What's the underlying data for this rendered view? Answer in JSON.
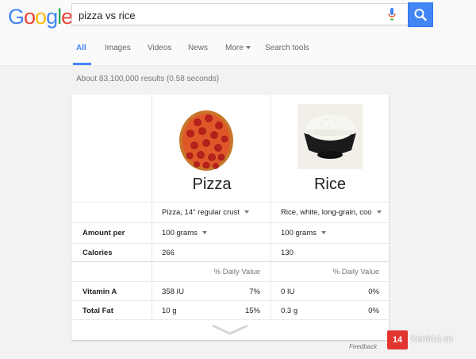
{
  "logo": {
    "letters": [
      "G",
      "o",
      "o",
      "g",
      "l",
      "e"
    ],
    "colors": [
      "#4285f4",
      "#ea4335",
      "#fbbc05",
      "#4285f4",
      "#34a853",
      "#ea4335"
    ]
  },
  "search": {
    "query": "pizza vs rice"
  },
  "tabs": [
    {
      "label": "All",
      "active": true
    },
    {
      "label": "Images"
    },
    {
      "label": "Videos"
    },
    {
      "label": "News"
    },
    {
      "label": "More"
    },
    {
      "label": "Search tools"
    }
  ],
  "results_stats": "About 83,100,000 results (0.58 seconds)",
  "comparison": {
    "foods": [
      {
        "name": "Pizza",
        "serving": "Pizza, 14\" regular crust",
        "amount": "100 grams",
        "calories": "266"
      },
      {
        "name": "Rice",
        "serving": "Rice, white, long-grain, coo",
        "amount": "100 grams",
        "calories": "130"
      }
    ],
    "row_labels": {
      "amount": "Amount per",
      "calories": "Calories",
      "vitamin_a": "Vitamin A",
      "total_fat": "Total Fat"
    },
    "daily_value_header": "% Daily Value",
    "nutrients": {
      "vitamin_a": [
        {
          "amount": "358 IU",
          "dv": "7%"
        },
        {
          "amount": "0 IU",
          "dv": "0%"
        }
      ],
      "total_fat": [
        {
          "amount": "10 g",
          "dv": "15%"
        },
        {
          "amount": "0.3 g",
          "dv": "0%"
        }
      ]
    }
  },
  "feedback": "Feedback",
  "watermark": {
    "badge": "14",
    "text": "Kenh14.vn"
  },
  "colors": {
    "accent": "#4285f4",
    "watermark_red": "#e23530"
  }
}
